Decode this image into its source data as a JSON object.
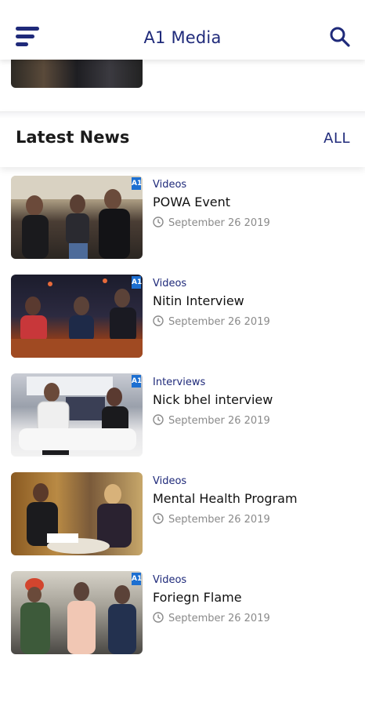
{
  "appbar": {
    "title": "A1 Media",
    "menu_icon": "menu-icon",
    "search_icon": "search-icon",
    "accent": "#1f2a7a"
  },
  "section": {
    "title": "Latest News",
    "all_label": "ALL"
  },
  "news": [
    {
      "category": "Videos",
      "title": "POWA Event",
      "date": "September 26 2019"
    },
    {
      "category": "Videos",
      "title": "Nitin Interview",
      "date": "September 26 2019"
    },
    {
      "category": "Interviews",
      "title": "Nick bhel interview",
      "date": "September 26 2019"
    },
    {
      "category": "Videos",
      "title": "Mental Health Program",
      "date": "September 26 2019"
    },
    {
      "category": "Videos",
      "title": "Foriegn Flame",
      "date": "September 26 2019"
    }
  ],
  "thumb_badge": "A1"
}
